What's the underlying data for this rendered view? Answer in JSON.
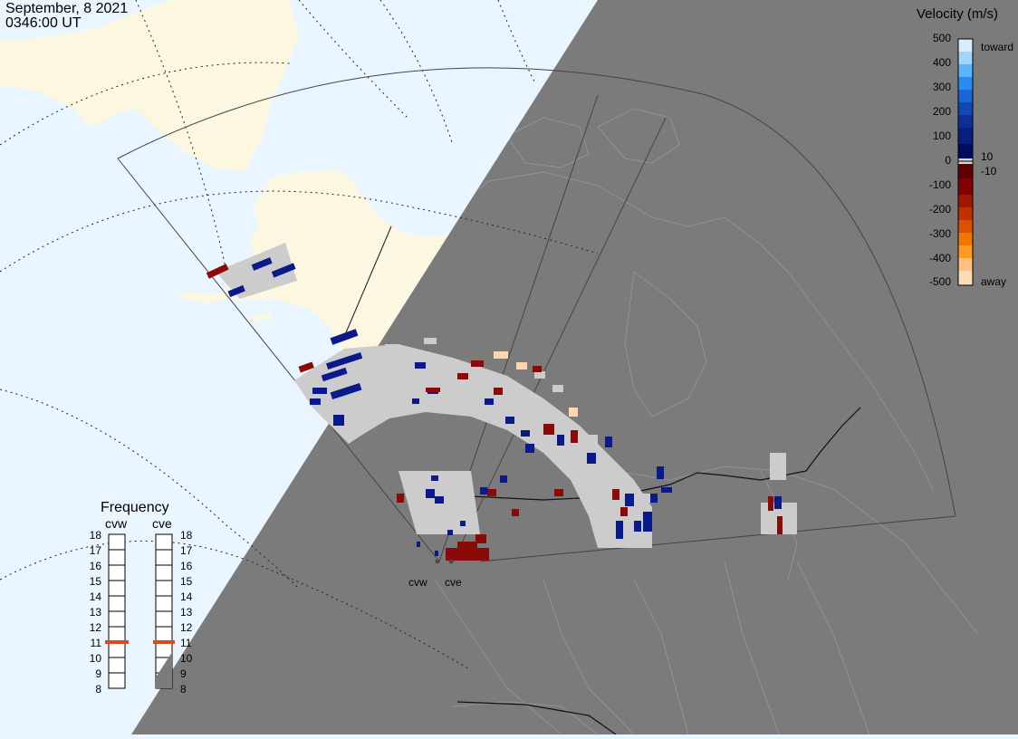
{
  "header": {
    "date": "September, 8 2021",
    "time": "0346:00 UT"
  },
  "colors": {
    "ocean": "#eaf6ff",
    "land": "#fbf7e0",
    "night": "#7b7b7b",
    "ground_scatter": "#cccccc",
    "toward_dark": "#0a1a8a",
    "away_dark": "#8a0a0a",
    "frequency_marker": "#e2461e"
  },
  "radars": [
    {
      "code": "cvw",
      "label": "cvw",
      "frequency_mhz": 11
    },
    {
      "code": "cve",
      "label": "cve",
      "frequency_mhz": 11
    }
  ],
  "velocity_legend": {
    "title": "Velocity (m/s)",
    "ticks": [
      "500",
      "400",
      "300",
      "200",
      "100",
      "0",
      "-100",
      "-200",
      "-300",
      "-400",
      "-500"
    ],
    "side_labels": {
      "toward": "toward",
      "plus_ten": "10",
      "minus_ten": "-10",
      "away": "away"
    }
  },
  "frequency_legend": {
    "title": "Frequency",
    "ticks": [
      "18",
      "17",
      "16",
      "15",
      "14",
      "13",
      "12",
      "11",
      "10",
      "9",
      "8"
    ]
  }
}
